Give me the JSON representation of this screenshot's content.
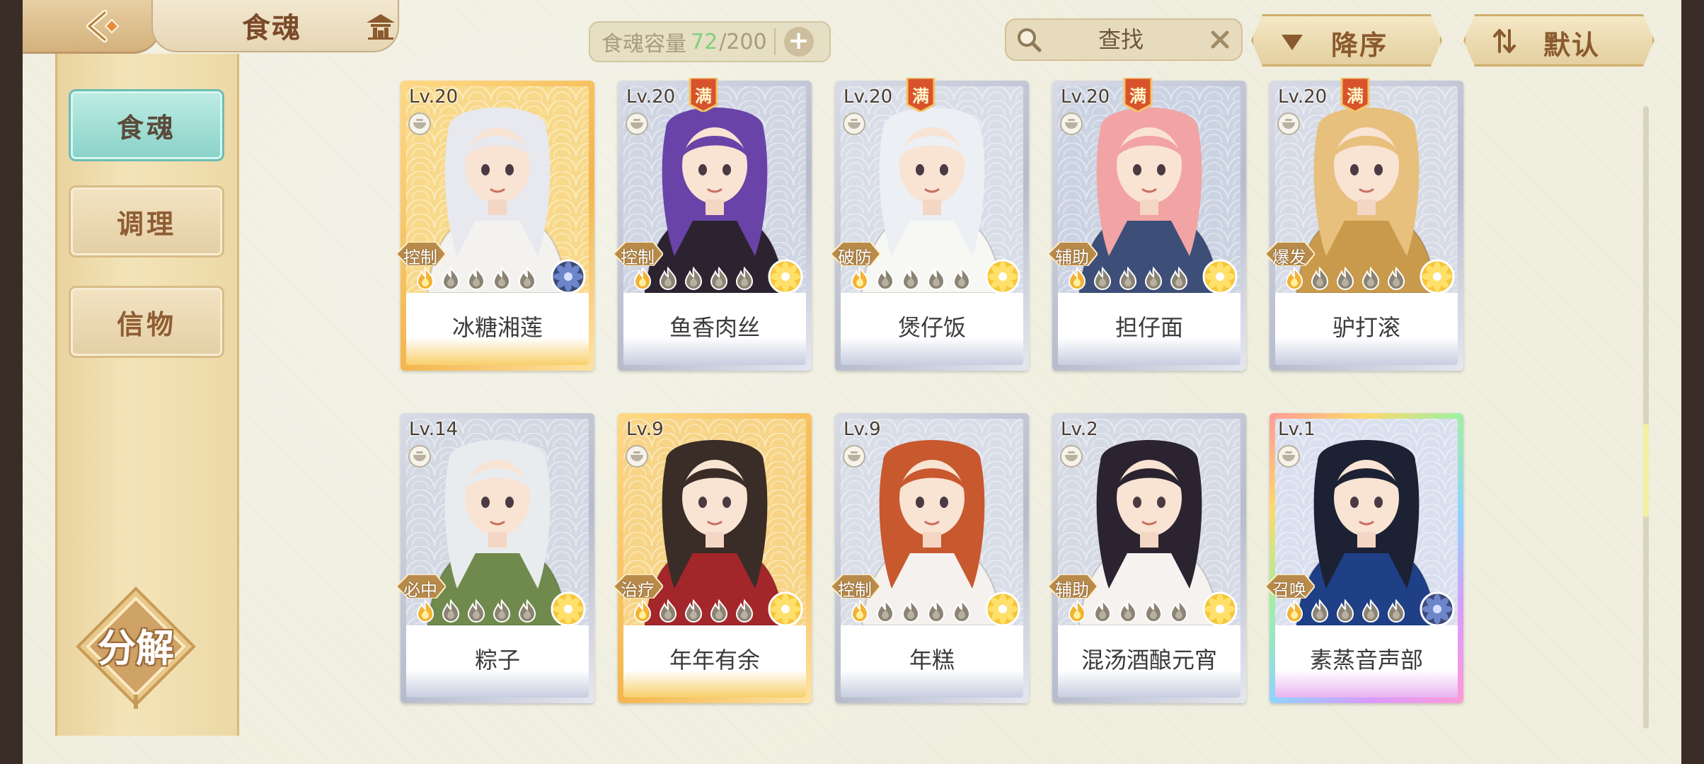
{
  "header": {
    "title": "食魂",
    "capacity_label": "食魂容量",
    "capacity_current": "72",
    "capacity_max": "200",
    "search_placeholder": "查找",
    "sort_order_label": "降序",
    "sort_mode_label": "默认"
  },
  "sidebar": {
    "tabs": [
      {
        "label": "食魂",
        "active": true
      },
      {
        "label": "调理",
        "active": false
      },
      {
        "label": "信物",
        "active": false
      }
    ],
    "decompose_label": "分解"
  },
  "scrollbar": {
    "position": 0.6,
    "visible_fraction": 0.15
  },
  "colors": {
    "accent_teal": "#88d2c8",
    "capacity_current": "#7fd07a",
    "frame_gold": "#f3b64f",
    "frame_silver": "#b7bccd",
    "text_brown": "#8a5a2e"
  },
  "cards": [
    {
      "level": "Lv.20",
      "name": "冰糖湘莲",
      "role": "控制",
      "full": false,
      "rarity": "gold",
      "flames_lit": 1,
      "flames_total": 5,
      "badge": "blue-flower-icon",
      "art": "#f8d98a",
      "hair": "#e7e9ef",
      "robe": "#f3f2ef"
    },
    {
      "level": "Lv.20",
      "name": "鱼香肉丝",
      "role": "控制",
      "full": true,
      "full_label": "满",
      "rarity": "silver",
      "flames_lit": 1,
      "flames_total": 5,
      "badge": "gold-flower-icon",
      "art": "#cfd5e3",
      "hair": "#6a43a8",
      "robe": "#2c2330"
    },
    {
      "level": "Lv.20",
      "name": "煲仔饭",
      "role": "破防",
      "full": true,
      "full_label": "满",
      "rarity": "silver",
      "flames_lit": 1,
      "flames_total": 5,
      "badge": "gold-flower-icon",
      "art": "#d8dde8",
      "hair": "#eceff3",
      "robe": "#f7f7f4"
    },
    {
      "level": "Lv.20",
      "name": "担仔面",
      "role": "辅助",
      "full": true,
      "full_label": "满",
      "rarity": "silver",
      "flames_lit": 1,
      "flames_total": 5,
      "badge": "gold-flower-icon",
      "art": "#cbd3e2",
      "hair": "#f2a3a3",
      "robe": "#3d4f78"
    },
    {
      "level": "Lv.20",
      "name": "驴打滚",
      "role": "爆发",
      "full": true,
      "full_label": "满",
      "rarity": "silver",
      "flames_lit": 1,
      "flames_total": 5,
      "badge": "gold-flower-icon",
      "art": "#d7dbe6",
      "hair": "#e7c07d",
      "robe": "#c99a4b"
    },
    {
      "level": "Lv.14",
      "name": "粽子",
      "role": "必中",
      "full": false,
      "rarity": "silver",
      "flames_lit": 1,
      "flames_total": 5,
      "badge": "gold-flower-icon",
      "art": "#d3d9e3",
      "hair": "#e9ecef",
      "robe": "#6f8a4c"
    },
    {
      "level": "Lv.9",
      "name": "年年有余",
      "role": "治疗",
      "full": false,
      "rarity": "gold",
      "flames_lit": 1,
      "flames_total": 5,
      "badge": "gold-flower-icon",
      "art": "#f7d486",
      "hair": "#3a2c26",
      "robe": "#a3262a"
    },
    {
      "level": "Lv.9",
      "name": "年糕",
      "role": "控制",
      "full": false,
      "rarity": "silver",
      "flames_lit": 1,
      "flames_total": 5,
      "badge": "gold-flower-icon",
      "art": "#d8dde7",
      "hair": "#c8582e",
      "robe": "#f4f1ee"
    },
    {
      "level": "Lv.2",
      "name": "混汤酒酿元宵",
      "role": "辅助",
      "full": false,
      "rarity": "silver",
      "flames_lit": 1,
      "flames_total": 5,
      "badge": "gold-flower-icon",
      "art": "#d5dae5",
      "hair": "#2b2430",
      "robe": "#f5f2f0"
    },
    {
      "level": "Lv.1",
      "name": "素蒸音声部",
      "role": "召唤",
      "full": false,
      "rarity": "rainbow",
      "flames_lit": 1,
      "flames_total": 5,
      "badge": "blue-flower-icon",
      "art": "#d9dfee",
      "hair": "#1c2234",
      "robe": "#1f3f86"
    }
  ]
}
